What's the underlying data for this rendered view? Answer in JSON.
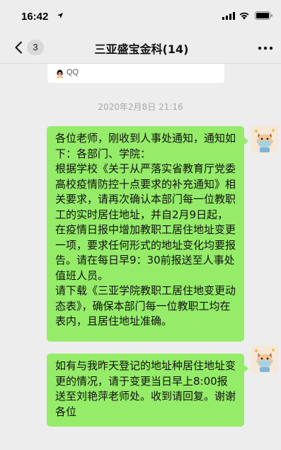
{
  "status_bar": {
    "time": "16:42",
    "icons": [
      "location-arrow-icon",
      "signal-icon",
      "wifi-icon",
      "battery-icon"
    ]
  },
  "nav": {
    "unread_count": "3",
    "title": "三亚盛宝金科(14)",
    "back_icon": "chevron-left-icon",
    "more_icon": "more-dots-icon"
  },
  "qq_card": {
    "label": "QQ",
    "icon": "qq-penguin-icon"
  },
  "timestamp": "2020年2月8日 21:16",
  "messages": [
    {
      "sender": "self",
      "text": "各位老师，刚收到人事处通知，通知如下：各部门、学院：\n根据学校《关于从严落实省教育厅党委高校疫情防控十点要求的补充通知》相关要求，请再次确认本部门每一位教职工的实时居住地址，并自2月9日起，在疫情日报中增加教职工居住地址变更一项，要求任何形式的地址变化均要报告。请在每日早9：30前报送至人事处值班人员。\n请下载《三亚学院教职工居住地变更动态表》，确保本部门每一位教职工均在表内，且居住地址准确。"
    },
    {
      "sender": "self",
      "text": "如有与我昨天登记的地址种居住地址变更的情况，请于变更当日早上8:00报送至刘艳萍老师处。收到请回复。谢谢各位"
    }
  ],
  "colors": {
    "background": "#ededed",
    "bubble_green": "#95ec69",
    "timestamp_gray": "#a8a8a8"
  }
}
